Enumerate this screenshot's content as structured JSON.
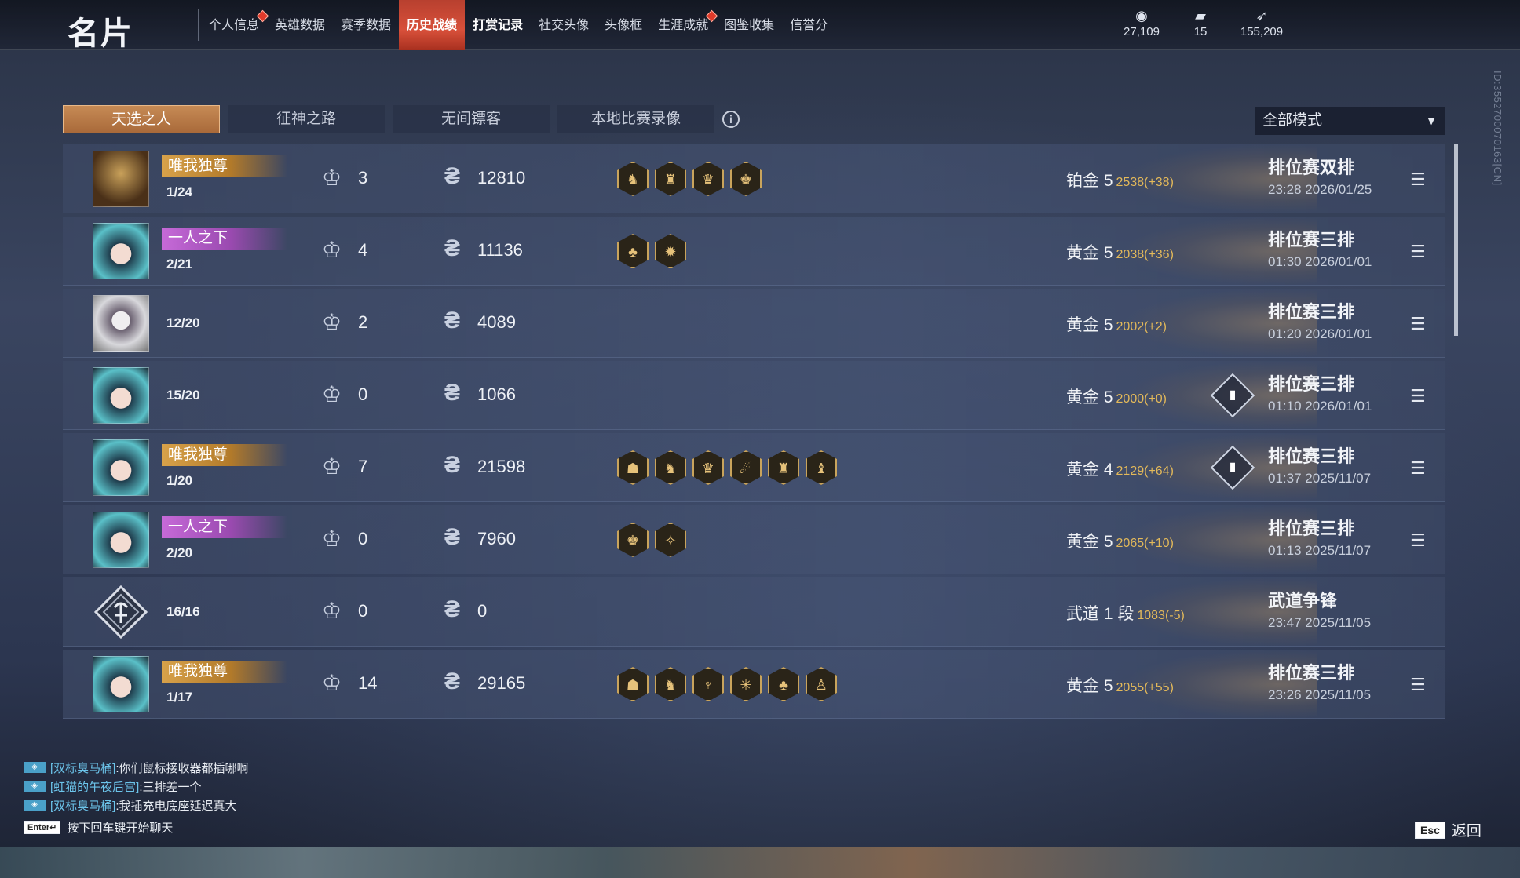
{
  "header": {
    "title": "名片",
    "tabs": [
      {
        "label": "个人信息",
        "dot": true
      },
      {
        "label": "英雄数据",
        "dot": false
      },
      {
        "label": "赛季数据",
        "dot": false
      },
      {
        "label": "历史战绩",
        "dot": false,
        "active": true
      },
      {
        "label": "打赏记录",
        "dot": false,
        "bold": true
      },
      {
        "label": "社交头像",
        "dot": false
      },
      {
        "label": "头像框",
        "dot": false
      },
      {
        "label": "生涯成就",
        "dot": true
      },
      {
        "label": "图鉴收集",
        "dot": false
      },
      {
        "label": "信誉分",
        "dot": false
      }
    ],
    "currencies": [
      {
        "icon": "coin-stack-icon",
        "value": "27,109"
      },
      {
        "icon": "ticket-icon",
        "value": "15"
      },
      {
        "icon": "feather-icon",
        "value": "155,209"
      }
    ]
  },
  "side_id": "ID:3552700070163[CN]",
  "subtabs": [
    "天选之人",
    "征神之路",
    "无间镖客",
    "本地比赛录像"
  ],
  "mode_select": "全部模式",
  "rows": [
    {
      "avatar": "gold",
      "tag": "唯我独尊",
      "tag_color": "gold",
      "rank": "1/24",
      "kills": "3",
      "score": "12810",
      "badges": [
        "♞",
        "♜",
        "♛",
        "♚"
      ],
      "tier": "铂金 5",
      "points": "2538(+38)",
      "graph": false,
      "match_type": "排位赛双排",
      "time": "23:28  2026/01/25",
      "detail": true
    },
    {
      "avatar": "teal",
      "tag": "一人之下",
      "tag_color": "purple",
      "rank": "2/21",
      "kills": "4",
      "score": "11136",
      "badges": [
        "♣",
        "✹"
      ],
      "tier": "黄金 5",
      "points": "2038(+36)",
      "graph": false,
      "match_type": "排位赛三排",
      "time": "01:30  2026/01/01",
      "detail": true
    },
    {
      "avatar": "mask",
      "tag": "",
      "tag_color": "",
      "rank": "12/20",
      "kills": "2",
      "score": "4089",
      "badges": [],
      "tier": "黄金 5",
      "points": "2002(+2)",
      "graph": false,
      "match_type": "排位赛三排",
      "time": "01:20  2026/01/01",
      "detail": true
    },
    {
      "avatar": "teal",
      "tag": "",
      "tag_color": "",
      "rank": "15/20",
      "kills": "0",
      "score": "1066",
      "badges": [],
      "tier": "黄金 5",
      "points": "2000(+0)",
      "graph": true,
      "match_type": "排位赛三排",
      "time": "01:10  2026/01/01",
      "detail": true
    },
    {
      "avatar": "teal",
      "tag": "唯我独尊",
      "tag_color": "gold",
      "rank": "1/20",
      "kills": "7",
      "score": "21598",
      "badges": [
        "☗",
        "♞",
        "♛",
        "☄",
        "♜",
        "♝"
      ],
      "tier": "黄金 4",
      "points": "2129(+64)",
      "graph": true,
      "match_type": "排位赛三排",
      "time": "01:37  2025/11/07",
      "detail": true
    },
    {
      "avatar": "teal",
      "tag": "一人之下",
      "tag_color": "purple",
      "rank": "2/20",
      "kills": "0",
      "score": "7960",
      "badges": [
        "♚",
        "✧"
      ],
      "tier": "黄金 5",
      "points": "2065(+10)",
      "graph": false,
      "match_type": "排位赛三排",
      "time": "01:13  2025/11/07",
      "detail": true
    },
    {
      "avatar": "emblem",
      "tag": "",
      "tag_color": "",
      "rank": "16/16",
      "kills": "0",
      "score": "0",
      "badges": [],
      "tier": "武道 1 段",
      "points": "1083(-5)",
      "graph": false,
      "match_type": "武道争锋",
      "time": "23:47  2025/11/05",
      "detail": false
    },
    {
      "avatar": "teal",
      "tag": "唯我独尊",
      "tag_color": "gold",
      "rank": "1/17",
      "kills": "14",
      "score": "29165",
      "badges": [
        "☗",
        "♞",
        "♆",
        "✳",
        "♣",
        "♙"
      ],
      "tier": "黄金 5",
      "points": "2055(+55)",
      "graph": false,
      "match_type": "排位赛三排",
      "time": "23:26  2025/11/05",
      "detail": true
    }
  ],
  "chat": [
    {
      "name": "[双标臭马桶]",
      "msg": ":你们鼠标接收器都插哪啊"
    },
    {
      "name": "[虹猫的午夜后宫]",
      "msg": ":三排差一个"
    },
    {
      "name": "[双标臭马桶]",
      "msg": ":我插充电底座延迟真大"
    }
  ],
  "chat_hint_key": "Enter↵",
  "chat_hint": "按下回车键开始聊天",
  "back_key": "Esc",
  "back_label": "返回"
}
